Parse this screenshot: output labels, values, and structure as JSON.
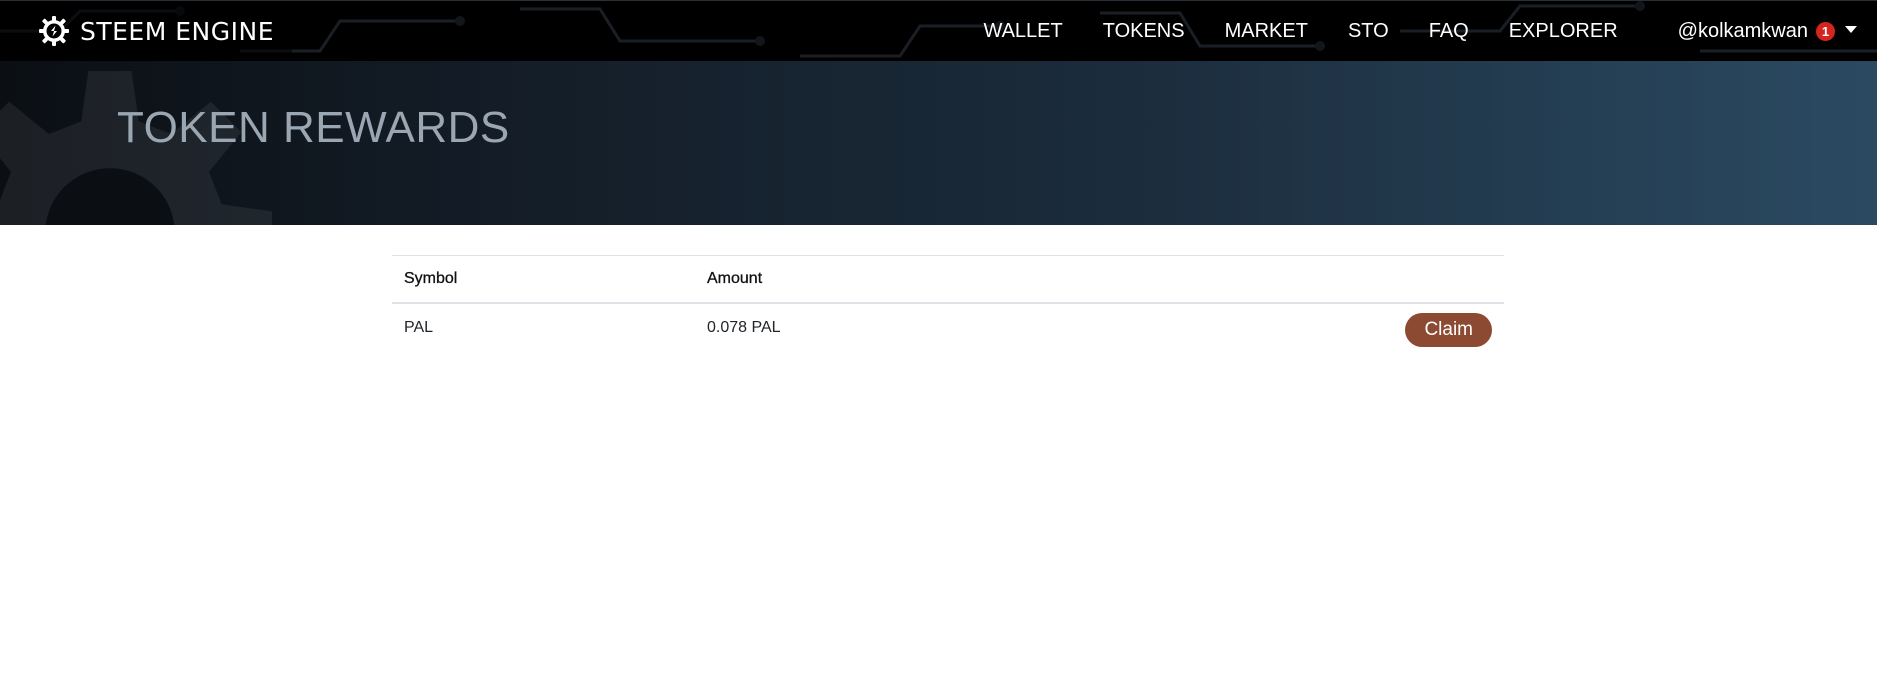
{
  "navbar": {
    "brand_text": "STEEM ENGINE",
    "brand_icon": "steem-engine-logo-icon",
    "links": [
      {
        "label": "WALLET"
      },
      {
        "label": "TOKENS"
      },
      {
        "label": "MARKET"
      },
      {
        "label": "STO"
      },
      {
        "label": "FAQ"
      },
      {
        "label": "EXPLORER"
      }
    ],
    "user": {
      "username": "@kolkamkwan",
      "notification_count": "1",
      "dropdown_icon": "caret-down-icon"
    }
  },
  "hero": {
    "title": "TOKEN REWARDS",
    "decoration_icon": "gear-icon"
  },
  "rewards_table": {
    "columns": [
      "Symbol",
      "Amount",
      ""
    ],
    "rows": [
      {
        "symbol": "PAL",
        "amount": "0.078 PAL",
        "action_label": "Claim"
      }
    ]
  },
  "colors": {
    "navbar_bg": "#000000",
    "hero_gradient_start": "#0b0f14",
    "hero_gradient_end": "#2b4a62",
    "hero_title": "#9aa6b2",
    "claim_button": "#8b4a31",
    "badge": "#d6241f"
  }
}
